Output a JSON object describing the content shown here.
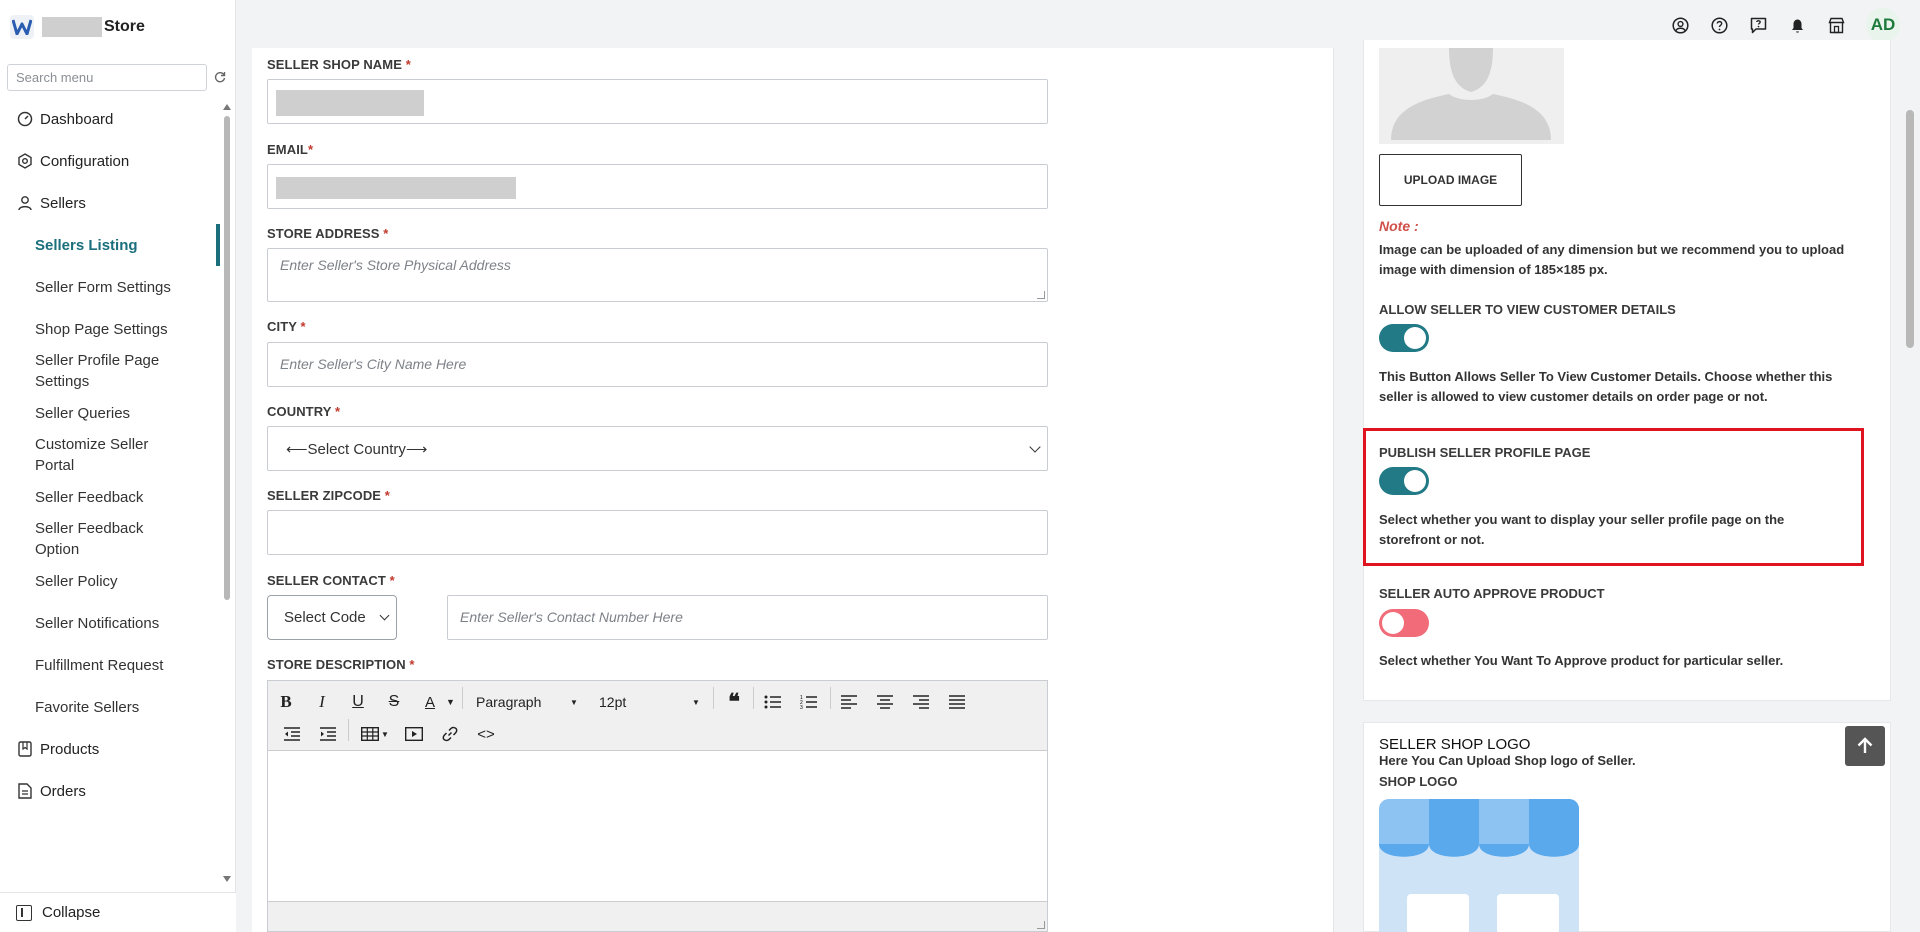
{
  "app": {
    "brand_name": "Store"
  },
  "sidebar": {
    "search_placeholder": "Search menu",
    "items": [
      {
        "label": "Dashboard",
        "icon": "dashboard-icon"
      },
      {
        "label": "Configuration",
        "icon": "gear-icon"
      },
      {
        "label": "Sellers",
        "icon": "user-icon"
      }
    ],
    "seller_sub": [
      "Sellers Listing",
      "Seller Form Settings",
      "Shop Page Settings",
      "Seller Profile Page Settings",
      "Seller Queries",
      "Customize Seller Portal",
      "Seller Feedback",
      "Seller Feedback Option",
      "Seller Policy",
      "Seller Notifications",
      "Fulfillment Request",
      "Favorite Sellers"
    ],
    "after": [
      {
        "label": "Products",
        "icon": "book-icon"
      },
      {
        "label": "Orders",
        "icon": "document-icon"
      }
    ],
    "collapse_label": "Collapse"
  },
  "topbar": {
    "avatar_initials": "AD"
  },
  "form": {
    "shop_name_label": "SELLER SHOP NAME",
    "email_label": "EMAIL",
    "address_label": "STORE ADDRESS",
    "address_placeholder": "Enter Seller's Store Physical Address",
    "city_label": "CITY",
    "city_placeholder": "Enter Seller's City Name Here",
    "country_label": "COUNTRY",
    "country_value": "⟵Select Country⟶",
    "zipcode_label": "SELLER ZIPCODE",
    "contact_label": "SELLER CONTACT",
    "code_value": "Select Code",
    "contact_placeholder": "Enter Seller's Contact Number Here",
    "description_label": "STORE DESCRIPTION",
    "required_mark": "*"
  },
  "editor": {
    "block_format": "Paragraph",
    "font_size": "12pt"
  },
  "right": {
    "upload_label": "UPLOAD IMAGE",
    "note_label": "Note :",
    "note_text": "Image can be uploaded of any dimension but we recommend you to upload image with dimension of 185×185 px.",
    "allow_label": "ALLOW SELLER TO VIEW CUSTOMER DETAILS",
    "allow_on": true,
    "allow_desc": "This Button Allows Seller To View Customer Details. Choose whether this seller is allowed to view customer details on order page or not.",
    "publish_label": "PUBLISH SELLER PROFILE PAGE",
    "publish_on": true,
    "publish_desc": "Select whether you want to display your seller profile page on the storefront or not.",
    "auto_label": "SELLER AUTO APPROVE PRODUCT",
    "auto_on": false,
    "auto_desc": "Select whether You Want To Approve product for particular seller.",
    "logo_title": "SELLER SHOP LOGO",
    "logo_sub": "Here You Can Upload Shop logo of Seller.",
    "logo_label": "SHOP LOGO"
  },
  "colors": {
    "accent": "#1b6f7d",
    "toggle_on": "#217a86",
    "toggle_off": "#f16b78",
    "highlight": "#e0141e"
  }
}
